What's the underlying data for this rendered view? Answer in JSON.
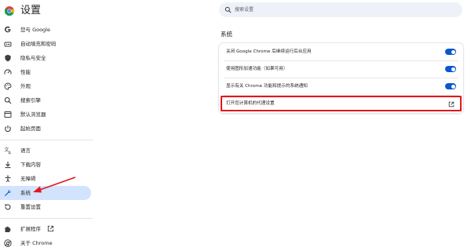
{
  "app": {
    "title": "设置"
  },
  "search": {
    "placeholder": "搜索设置"
  },
  "sidebar": {
    "items": [
      {
        "label": "您与 Google",
        "icon": "google-g-icon"
      },
      {
        "label": "自动填充和密码",
        "icon": "autofill-icon"
      },
      {
        "label": "隐私与安全",
        "icon": "shield-icon"
      },
      {
        "label": "性能",
        "icon": "speedometer-icon"
      },
      {
        "label": "外观",
        "icon": "palette-icon"
      },
      {
        "label": "搜索引擎",
        "icon": "search-icon"
      },
      {
        "label": "默认浏览器",
        "icon": "browser-window-icon"
      },
      {
        "label": "起始页面",
        "icon": "power-icon"
      },
      {
        "label": "语言",
        "icon": "translate-icon"
      },
      {
        "label": "下载内容",
        "icon": "download-icon"
      },
      {
        "label": "无障碍",
        "icon": "accessibility-icon"
      },
      {
        "label": "系统",
        "icon": "wrench-icon",
        "active": true
      },
      {
        "label": "重置设置",
        "icon": "reset-icon"
      },
      {
        "label": "扩展程序",
        "icon": "puzzle-icon"
      },
      {
        "label": "关于 Chrome",
        "icon": "chrome-icon"
      }
    ]
  },
  "main": {
    "section_title": "系统",
    "rows": [
      {
        "label": "关闭 Google Chrome 后继续运行后台应用",
        "toggle_on": true
      },
      {
        "label": "使用图形加速功能（如果可用）",
        "toggle_on": true
      },
      {
        "label": "显示有关 Chrome 功能和提示的系统通知",
        "toggle_on": true
      },
      {
        "label": "打开您计算机的代理设置",
        "icon": "open-in-new-icon"
      }
    ]
  },
  "colors": {
    "accent": "#0b57d0",
    "active_nav_bg": "#d3e3fd",
    "annotation_red": "#e3161c"
  }
}
